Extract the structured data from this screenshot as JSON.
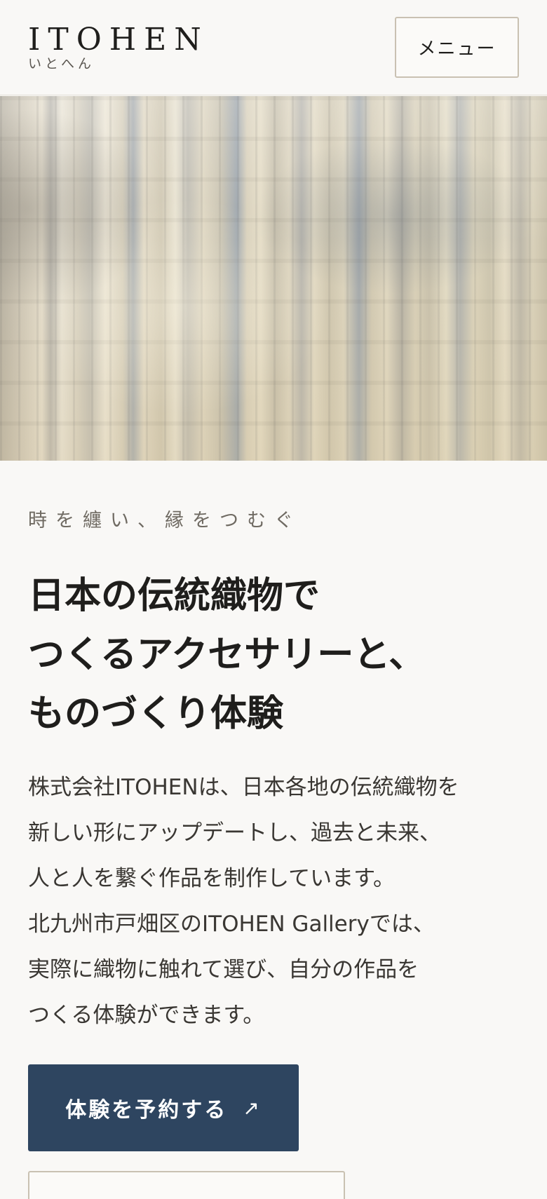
{
  "header": {
    "logo_main": "ITOHEN",
    "logo_sub": "いとへん",
    "menu_label": "メニュー"
  },
  "hero": {
    "tagline": "時を纏い、縁をつむぐ",
    "headline_lines": [
      "日本の伝統織物で",
      "つくるアクセサリーと、",
      "ものづくり体験"
    ],
    "body_lines": [
      "株式会社ITOHENは、日本各地の伝統織物を",
      "新しい形にアップデートし、過去と未来、",
      "人と人を繋ぐ作品を制作しています。",
      "北九州市戸畑区のITOHEN Galleryでは、",
      "実際に織物に触れて選び、自分の作品を",
      "つくる体験ができます。"
    ]
  },
  "cta": {
    "label": "体験を予約する",
    "arrow_icon": "↗"
  },
  "colors": {
    "background": "#f9f8f6",
    "cta_background": "#2e4560",
    "button_border": "#c9c1b2"
  }
}
